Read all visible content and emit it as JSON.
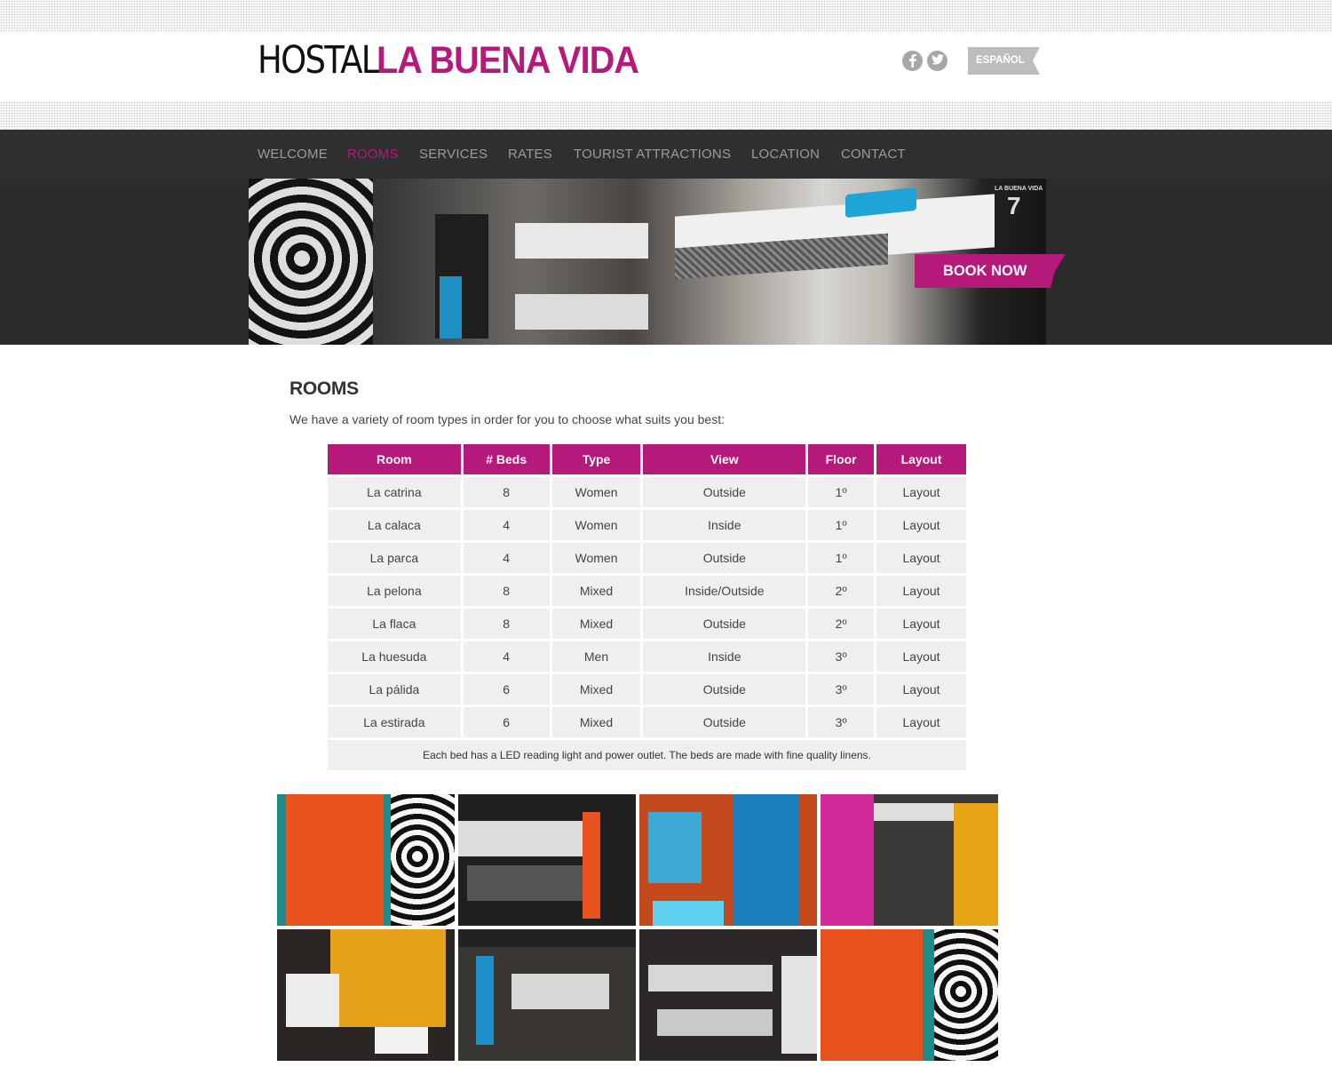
{
  "header": {
    "logo_thin": "HOSTAL",
    "logo_bold": "LA BUENA VIDA",
    "language_button": "ESPAÑOL",
    "social": [
      {
        "name": "facebook",
        "glyph": "f"
      },
      {
        "name": "twitter",
        "glyph": "t"
      }
    ]
  },
  "nav": {
    "items": [
      {
        "label": "WELCOME",
        "active": false
      },
      {
        "label": "ROOMS",
        "active": true
      },
      {
        "label": "SERVICES",
        "active": false
      },
      {
        "label": "RATES",
        "active": false
      },
      {
        "label": "TOURIST ATTRACTIONS",
        "active": false
      },
      {
        "label": "LOCATION",
        "active": false
      },
      {
        "label": "CONTACT",
        "active": false
      }
    ]
  },
  "hero": {
    "book_now": "BOOK NOW",
    "sign_text": "LA BUENA VIDA",
    "sign_number": "7"
  },
  "main": {
    "title": "ROOMS",
    "intro": "We have a variety of room types in order for you to choose what suits you best:",
    "table": {
      "headers": [
        "Room",
        "# Beds",
        "Type",
        "View",
        "Floor",
        "Layout"
      ],
      "rows": [
        [
          "La catrina",
          "8",
          "Women",
          "Outside",
          "1º",
          "Layout"
        ],
        [
          "La calaca",
          "4",
          "Women",
          "Inside",
          "1º",
          "Layout"
        ],
        [
          "La parca",
          "4",
          "Women",
          "Outside",
          "1º",
          "Layout"
        ],
        [
          "La pelona",
          "8",
          "Mixed",
          "Inside/Outside",
          "2º",
          "Layout"
        ],
        [
          "La flaca",
          "8",
          "Mixed",
          "Outside",
          "2º",
          "Layout"
        ],
        [
          "La huesuda",
          "4",
          "Men",
          "Inside",
          "3º",
          "Layout"
        ],
        [
          "La pálida",
          "6",
          "Mixed",
          "Outside",
          "3º",
          "Layout"
        ],
        [
          "La estirada",
          "6",
          "Mixed",
          "Outside",
          "3º",
          "Layout"
        ]
      ],
      "note": "Each bed has a LED reading light and power outlet. The beds are made with fine quality linens."
    }
  },
  "colors": {
    "accent": "#b5197a",
    "nav_bg": "#2f2f2f",
    "nav_text": "#9b9b9b",
    "table_cell": "#efefef"
  }
}
